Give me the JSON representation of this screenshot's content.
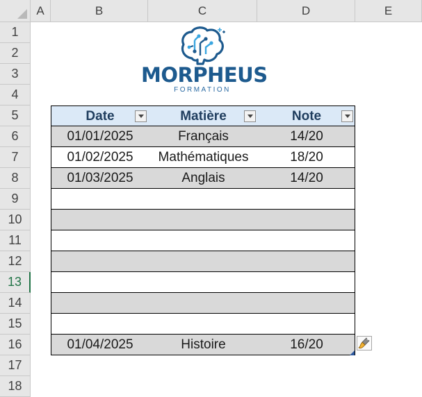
{
  "spreadsheet": {
    "columns": [
      "A",
      "B",
      "C",
      "D",
      "E"
    ],
    "rows": [
      "1",
      "2",
      "3",
      "4",
      "5",
      "6",
      "7",
      "8",
      "9",
      "10",
      "11",
      "12",
      "13",
      "14",
      "15",
      "16",
      "17",
      "18"
    ],
    "active_row": "13"
  },
  "logo": {
    "name": "MORPHEUS",
    "subtitle": "FORMATION",
    "colors": {
      "primary": "#1d5a8e",
      "accent": "#3aa6e0"
    }
  },
  "table": {
    "headers": [
      "Date",
      "Matière",
      "Note"
    ],
    "rows": [
      [
        "01/01/2025",
        "Français",
        "14/20"
      ],
      [
        "01/02/2025",
        "Mathématiques",
        "18/20"
      ],
      [
        "01/03/2025",
        "Anglais",
        "14/20"
      ],
      [
        "",
        "",
        ""
      ],
      [
        "",
        "",
        ""
      ],
      [
        "",
        "",
        ""
      ],
      [
        "",
        "",
        ""
      ],
      [
        "",
        "",
        ""
      ],
      [
        "",
        "",
        ""
      ],
      [
        "",
        "",
        ""
      ],
      [
        "01/04/2025",
        "Histoire",
        "16/20"
      ]
    ],
    "colors": {
      "header_fill": "#dbe9f7",
      "band_fill": "#d9d9d9",
      "header_text": "#1f3d5e"
    }
  },
  "icons": {
    "filter": "filter-dropdown-icon",
    "quick_analysis": "paintbrush-icon",
    "resize": "table-resize-handle-icon"
  }
}
